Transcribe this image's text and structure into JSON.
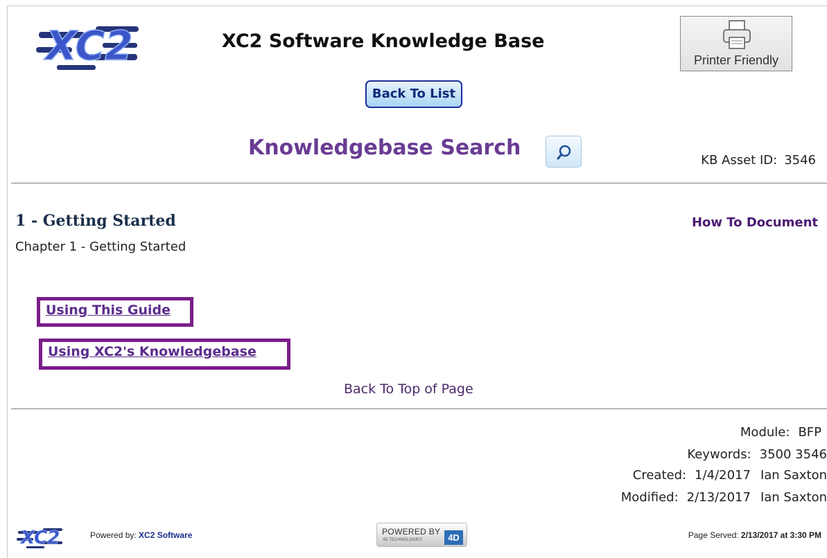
{
  "header": {
    "logo_text": "XC2",
    "site_title": "XC2 Software Knowledge Base",
    "printer_button_label": "Printer Friendly",
    "back_to_list_label": "Back To List",
    "search_title": "Knowledgebase Search",
    "asset_id_label": "KB Asset ID:",
    "asset_id_value": "3546"
  },
  "document": {
    "title": "1 - Getting Started",
    "type": "How To Document",
    "subtitle": "Chapter 1 - Getting Started",
    "links": [
      {
        "label": "Using This Guide"
      },
      {
        "label": "Using XC2's Knowledgebase"
      }
    ],
    "back_to_top_label": "Back To Top of Page"
  },
  "meta": {
    "module_label": "Module:",
    "module_value": "BFP",
    "keywords_label": "Keywords:",
    "keywords_value": "3500 3546",
    "created_label": "Created:",
    "created_date": "1/4/2017",
    "created_by": "Ian Saxton",
    "modified_label": "Modified:",
    "modified_date": "2/13/2017",
    "modified_by": "Ian Saxton"
  },
  "footer": {
    "powered_by_label": "Powered by:",
    "powered_by_name": "XC2 Software",
    "badge_line1": "POWERED BY",
    "badge_line2": "4D TECHNOLOGIES",
    "badge_logo": "4D",
    "page_served_label": "Page Served:",
    "page_served_value": "2/13/2017 at 3:30 PM"
  },
  "colors": {
    "accent_purple": "#6a3c94",
    "link_border": "#7a1e8a",
    "button_blue": "#1b2f9a"
  },
  "icons": [
    "xc2-logo",
    "printer-icon",
    "search-icon",
    "4d-logo"
  ]
}
